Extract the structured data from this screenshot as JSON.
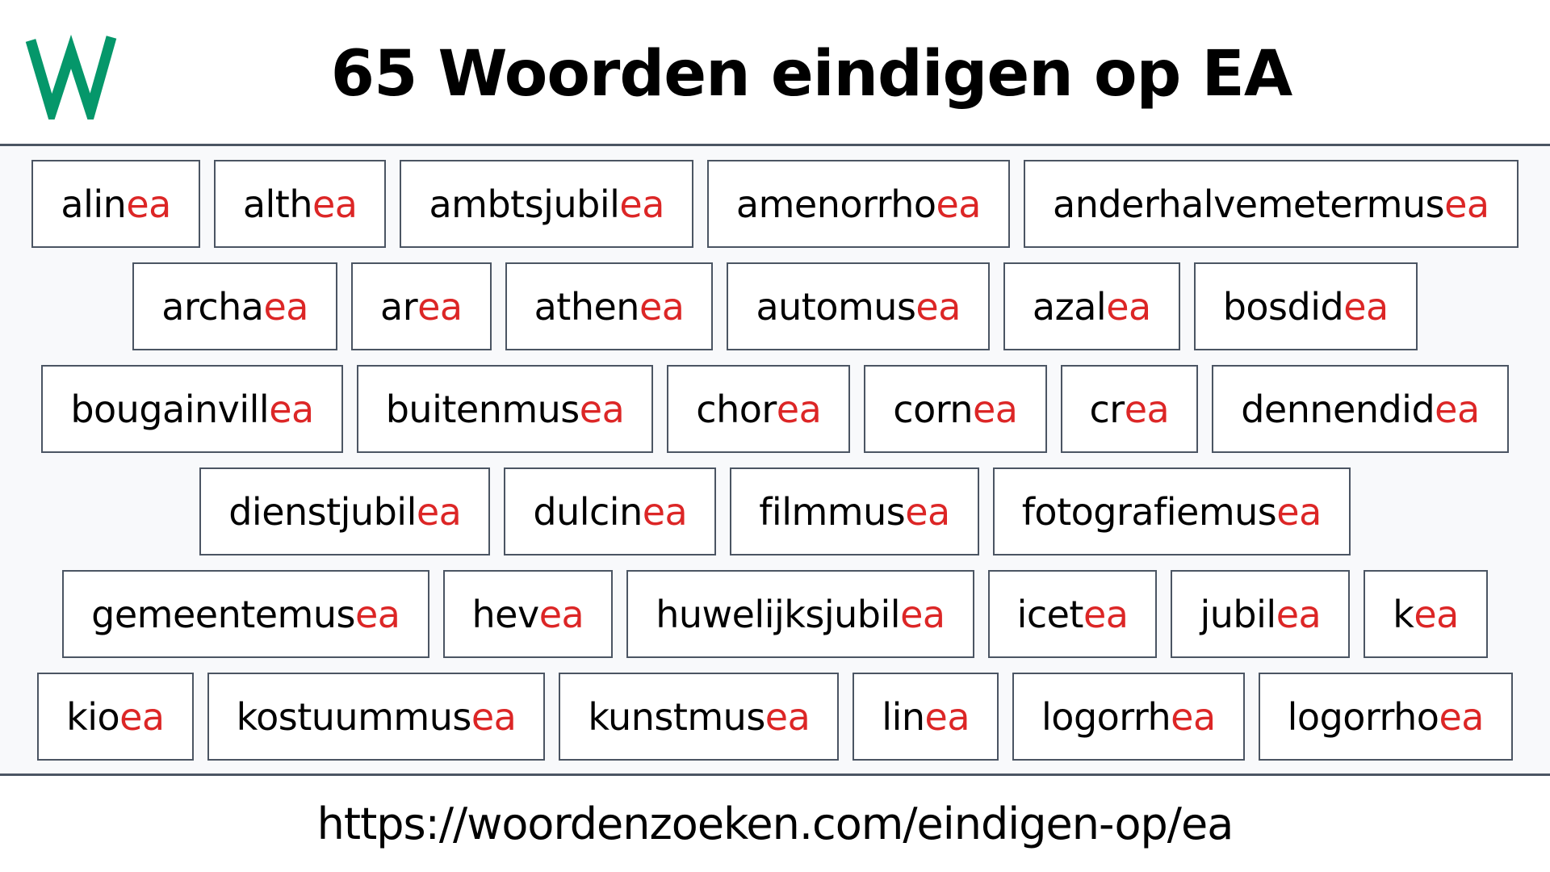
{
  "header": {
    "logo_letter": "W",
    "title": "65 Woorden eindigen op EA"
  },
  "colors": {
    "brand_green": "#05976a",
    "suffix_red": "#dc2626",
    "border": "#4b5563",
    "panel_bg": "#f8f9fb"
  },
  "suffix": "ea",
  "rows": [
    [
      {
        "stem": "alin",
        "suffix": "ea"
      },
      {
        "stem": "alth",
        "suffix": "ea"
      },
      {
        "stem": "ambtsjubil",
        "suffix": "ea"
      },
      {
        "stem": "amenorrho",
        "suffix": "ea"
      },
      {
        "stem": "anderhalvemetermus",
        "suffix": "ea"
      }
    ],
    [
      {
        "stem": "archa",
        "suffix": "ea"
      },
      {
        "stem": "ar",
        "suffix": "ea"
      },
      {
        "stem": "athen",
        "suffix": "ea"
      },
      {
        "stem": "automus",
        "suffix": "ea"
      },
      {
        "stem": "azal",
        "suffix": "ea"
      },
      {
        "stem": "bosdid",
        "suffix": "ea"
      }
    ],
    [
      {
        "stem": "bougainvill",
        "suffix": "ea"
      },
      {
        "stem": "buitenmus",
        "suffix": "ea"
      },
      {
        "stem": "chor",
        "suffix": "ea"
      },
      {
        "stem": "corn",
        "suffix": "ea"
      },
      {
        "stem": "cr",
        "suffix": "ea"
      },
      {
        "stem": "dennendid",
        "suffix": "ea"
      }
    ],
    [
      {
        "stem": "dienstjubil",
        "suffix": "ea"
      },
      {
        "stem": "dulcin",
        "suffix": "ea"
      },
      {
        "stem": "filmmus",
        "suffix": "ea"
      },
      {
        "stem": "fotografiemus",
        "suffix": "ea"
      }
    ],
    [
      {
        "stem": "gemeentemus",
        "suffix": "ea"
      },
      {
        "stem": "hev",
        "suffix": "ea"
      },
      {
        "stem": "huwelijksjubil",
        "suffix": "ea"
      },
      {
        "stem": "icet",
        "suffix": "ea"
      },
      {
        "stem": "jubil",
        "suffix": "ea"
      },
      {
        "stem": "k",
        "suffix": "ea"
      }
    ],
    [
      {
        "stem": "kio",
        "suffix": "ea"
      },
      {
        "stem": "kostuummus",
        "suffix": "ea"
      },
      {
        "stem": "kunstmus",
        "suffix": "ea"
      },
      {
        "stem": "lin",
        "suffix": "ea"
      },
      {
        "stem": "logorrh",
        "suffix": "ea"
      },
      {
        "stem": "logorrho",
        "suffix": "ea"
      }
    ]
  ],
  "footer": {
    "url": "https://woordenzoeken.com/eindigen-op/ea"
  }
}
